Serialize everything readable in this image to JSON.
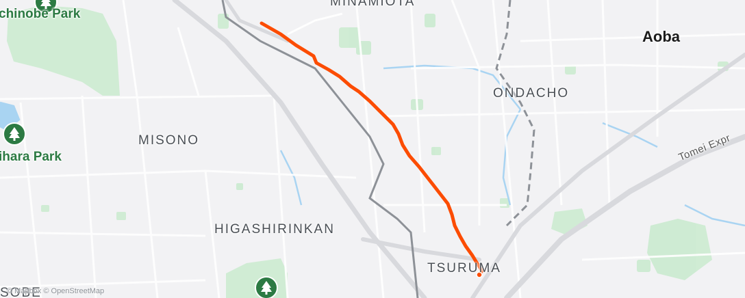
{
  "map": {
    "labels": {
      "minamiota": "MINAMIOTA",
      "aoba": "Aoba",
      "ondacho": "ONDACHO",
      "misono": "MISONO",
      "higashirinkan": "HIGASHIRINKAN",
      "tsuruma": "TSURUMA",
      "sobe": "SOBE",
      "tomei": "Tomei Expr"
    },
    "parks": {
      "top": "chinobe Park",
      "left": "ihara Park"
    },
    "attribution": "© Mapbox © OpenStreetMap",
    "colors": {
      "route": "#fc4c02",
      "park_fill": "#cdebd2",
      "park_icon": "#2c7a43",
      "road": "#ffffff",
      "highway": "#d8d9dd",
      "rail": "#8d9197",
      "water": "#a9d4f2",
      "background": "#f2f2f4"
    },
    "icons": [
      "tree-icon",
      "tree-icon",
      "tree-icon"
    ]
  }
}
